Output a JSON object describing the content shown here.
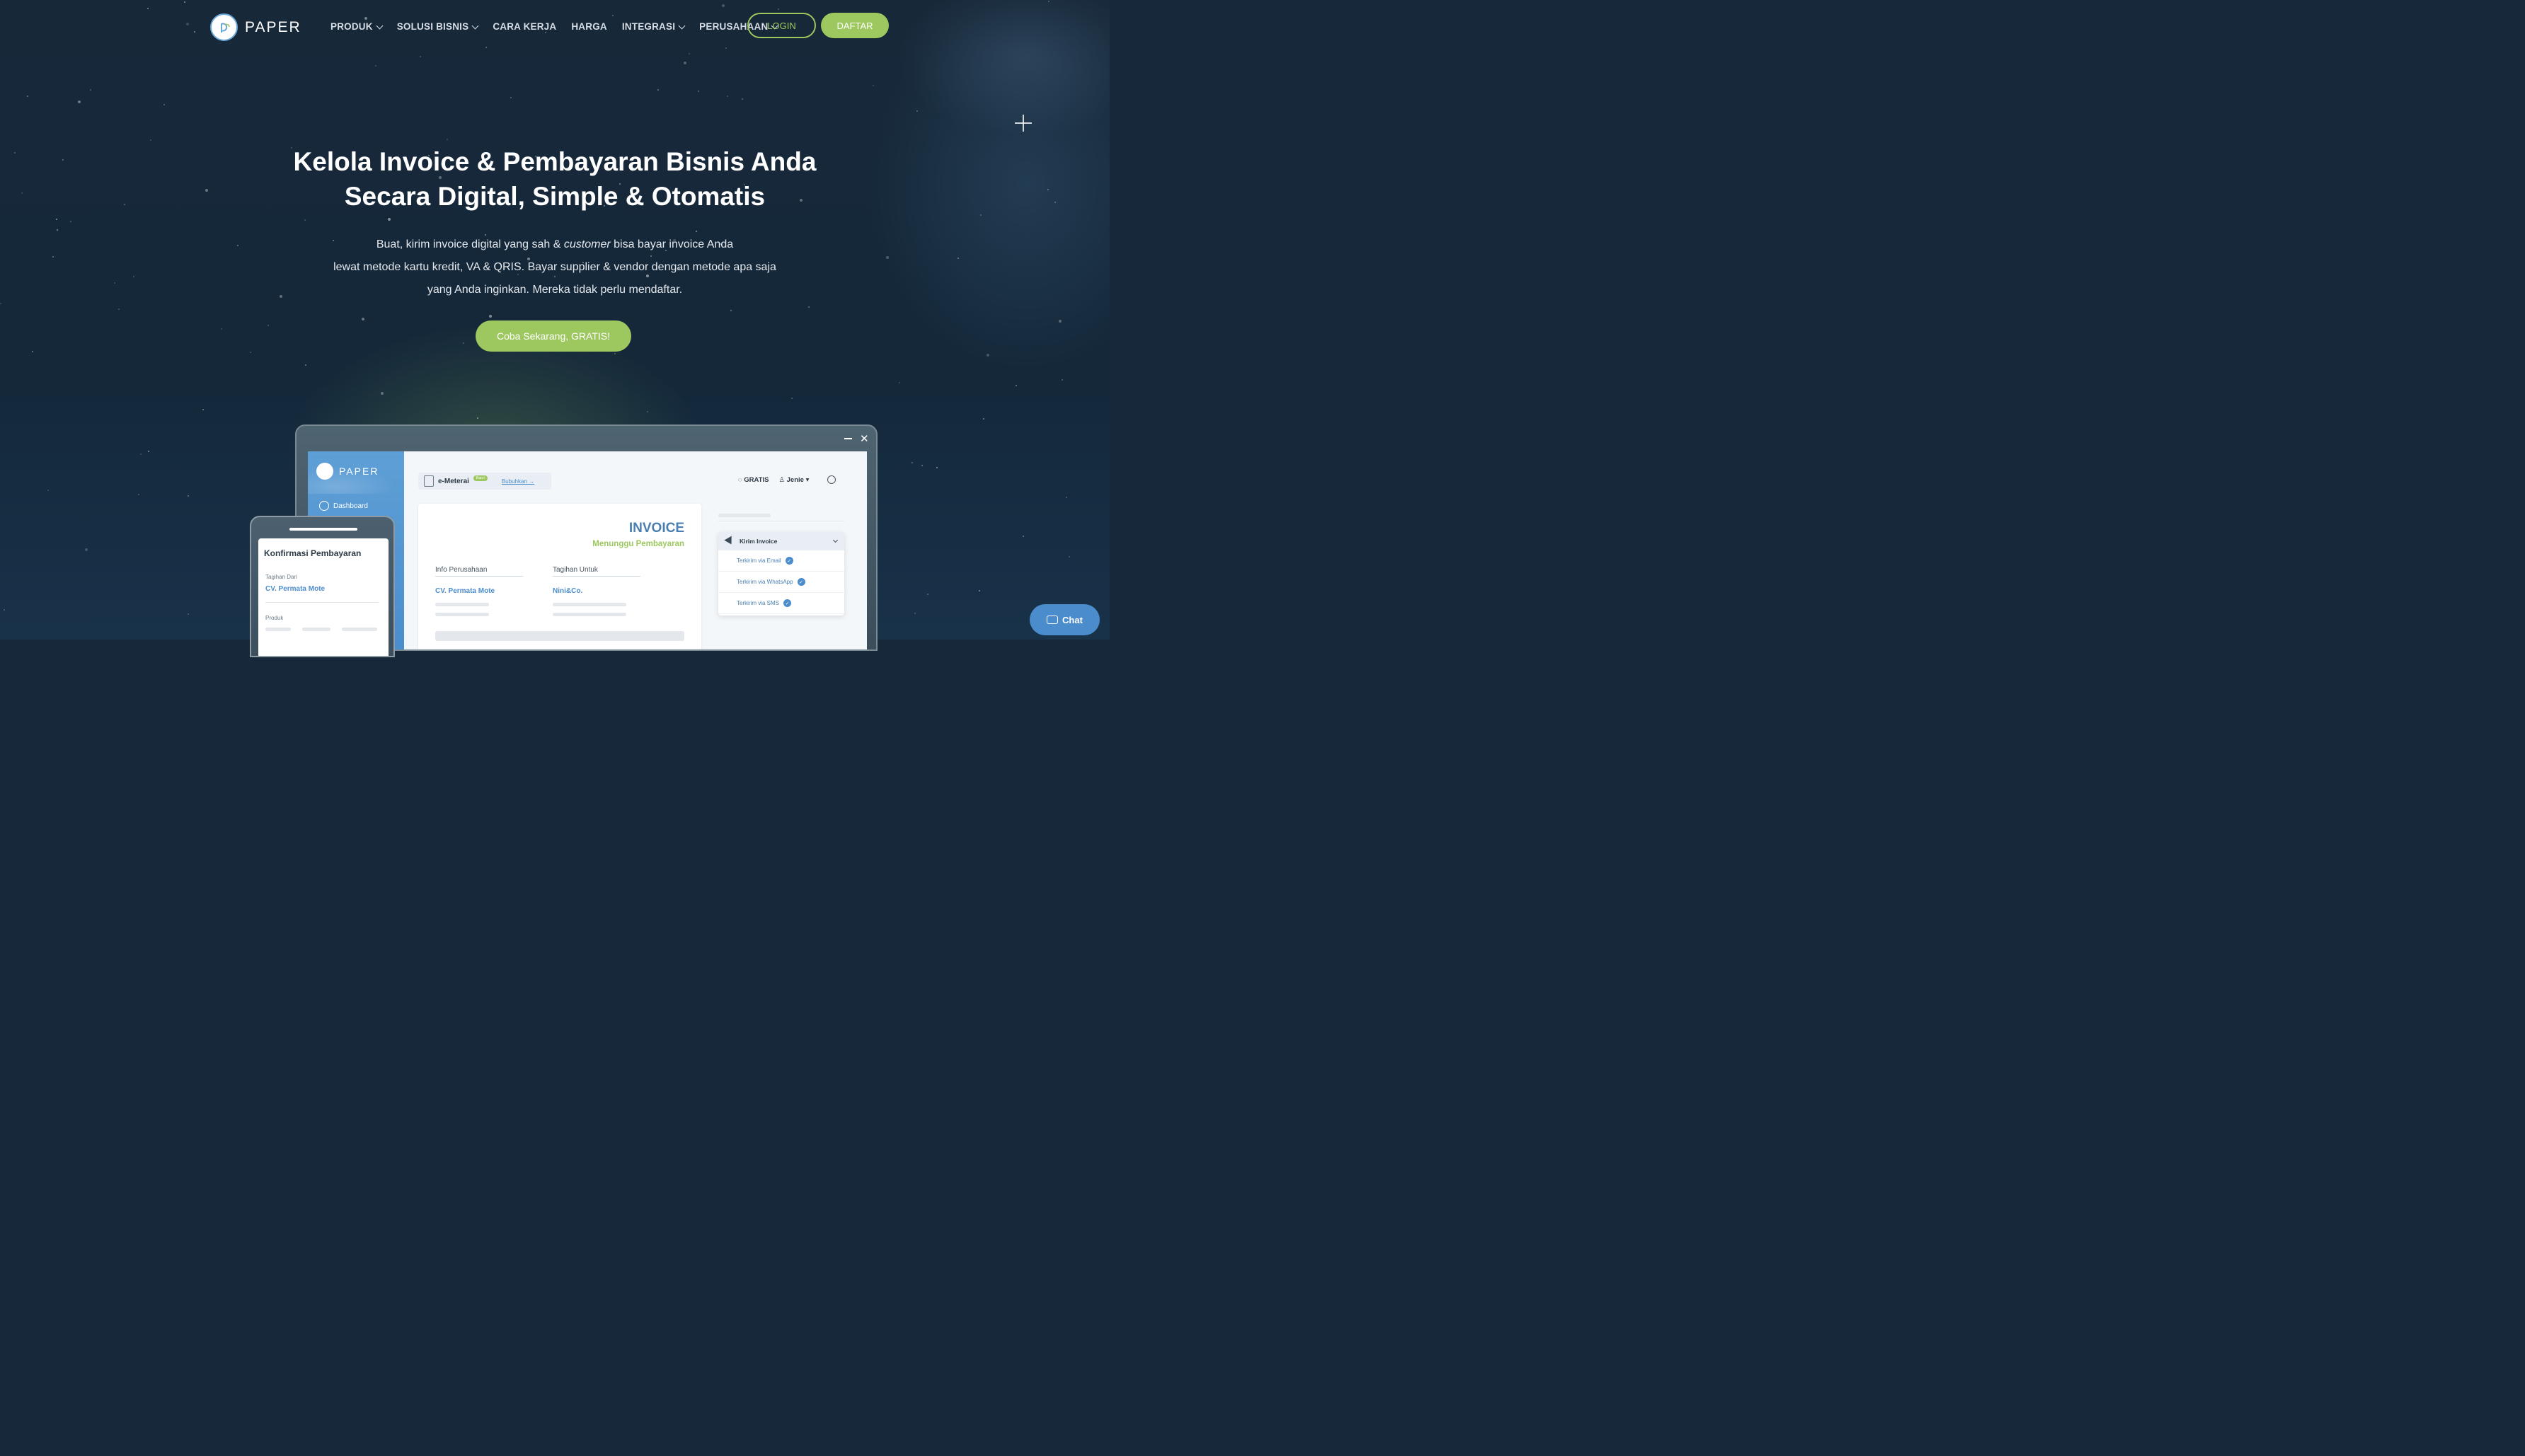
{
  "header": {
    "brand": "PAPER",
    "nav": [
      {
        "label": "PRODUK",
        "dropdown": true
      },
      {
        "label": "SOLUSI BISNIS",
        "dropdown": true
      },
      {
        "label": "CARA KERJA",
        "dropdown": false
      },
      {
        "label": "HARGA",
        "dropdown": false
      },
      {
        "label": "INTEGRASI",
        "dropdown": true
      },
      {
        "label": "PERUSAHAAN",
        "dropdown": true
      }
    ],
    "login_label": "LOGIN",
    "register_label": "DAFTAR"
  },
  "hero": {
    "title_line1": "Kelola Invoice & Pembayaran Bisnis Anda",
    "title_line2": "Secara Digital, Simple & Otomatis",
    "sub_line1_pre": "Buat, kirim invoice digital yang sah & ",
    "sub_line1_em": "customer",
    "sub_line1_post": " bisa bayar invoice Anda",
    "sub_line2": "lewat metode kartu kredit, VA & QRIS. Bayar supplier & vendor dengan metode apa saja",
    "sub_line3": "yang Anda inginkan. Mereka tidak perlu mendaftar.",
    "cta_label": "Coba Sekarang, GRATIS!"
  },
  "app_mockup": {
    "brand": "PAPER",
    "sidebar_item": "Dashboard",
    "emeterai_label": "e-Meterai",
    "emeterai_badge": "Baru!",
    "emeterai_link": "Bubuhkan →",
    "plan_label": "GRATIS",
    "user_label": "Jenie",
    "invoice_title": "INVOICE",
    "invoice_status": "Menunggu Pembayaran",
    "company_label": "Info Perusahaan",
    "company_value": "CV. Permata Mote",
    "billto_label": "Tagihan Untuk",
    "billto_value": "Nini&Co.",
    "send_panel_title": "Kirim Invoice",
    "send_options": [
      "Terkirim via Email",
      "Terkirim via WhatsApp",
      "Terkirim via SMS"
    ]
  },
  "phone_mockup": {
    "title": "Konfirmasi Pembayaran",
    "from_label": "Tagihan Dari",
    "from_value": "CV. Permata Mote",
    "product_label": "Produk"
  },
  "chat": {
    "label": "Chat"
  },
  "colors": {
    "accent_green": "#9dc85f",
    "accent_blue": "#4b8dcc",
    "bg_navy": "#16283a"
  }
}
